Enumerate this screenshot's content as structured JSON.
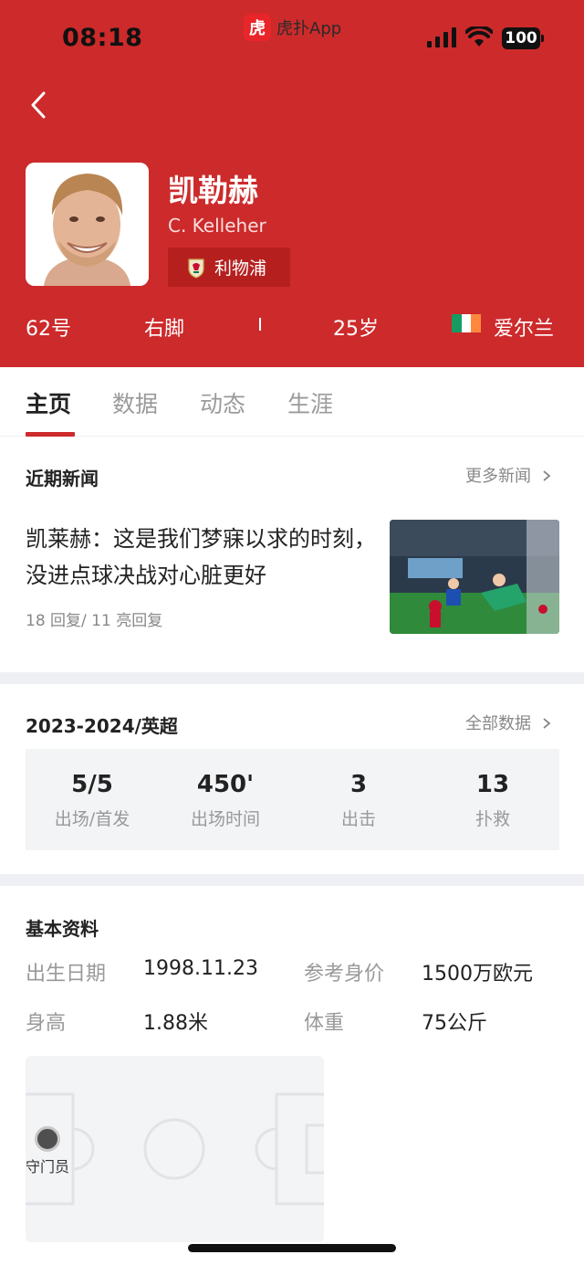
{
  "status_bar": {
    "time": "08:18",
    "app_logo_char": "虎",
    "app_name": "虎扑App",
    "battery": "100"
  },
  "player": {
    "name_cn": "凯勒赫",
    "name_en": "C. Kelleher",
    "club": "利物浦",
    "number": "62号",
    "foot": "右脚",
    "age": "25岁",
    "nationality": "爱尔兰",
    "flag_colors": [
      "#169b62",
      "#ffffff",
      "#ff883e"
    ]
  },
  "tabs": [
    "主页",
    "数据",
    "动态",
    "生涯"
  ],
  "news": {
    "section_title": "近期新闻",
    "more_label": "更多新闻",
    "headline": "凯莱赫：这是我们梦寐以求的时刻，没进点球决战对心脏更好",
    "meta": "18 回复/ 11 亮回复"
  },
  "season": {
    "title": "2023-2024/英超",
    "more_label": "全部数据",
    "stats": [
      {
        "value": "5/5",
        "label": "出场/首发"
      },
      {
        "value": "450'",
        "label": "出场时间"
      },
      {
        "value": "3",
        "label": "出击"
      },
      {
        "value": "13",
        "label": "扑救"
      }
    ]
  },
  "basic": {
    "title": "基本资料",
    "birth_label": "出生日期",
    "birth_value": "1998.11.23",
    "value_label": "参考身价",
    "value_value": "1500万欧元",
    "height_label": "身高",
    "height_value": "1.88米",
    "weight_label": "体重",
    "weight_value": "75公斤"
  },
  "position": {
    "label": "守门员"
  },
  "colors": {
    "brand_red": "#cd2a2b",
    "club_badge_bg": "#b5201f"
  }
}
